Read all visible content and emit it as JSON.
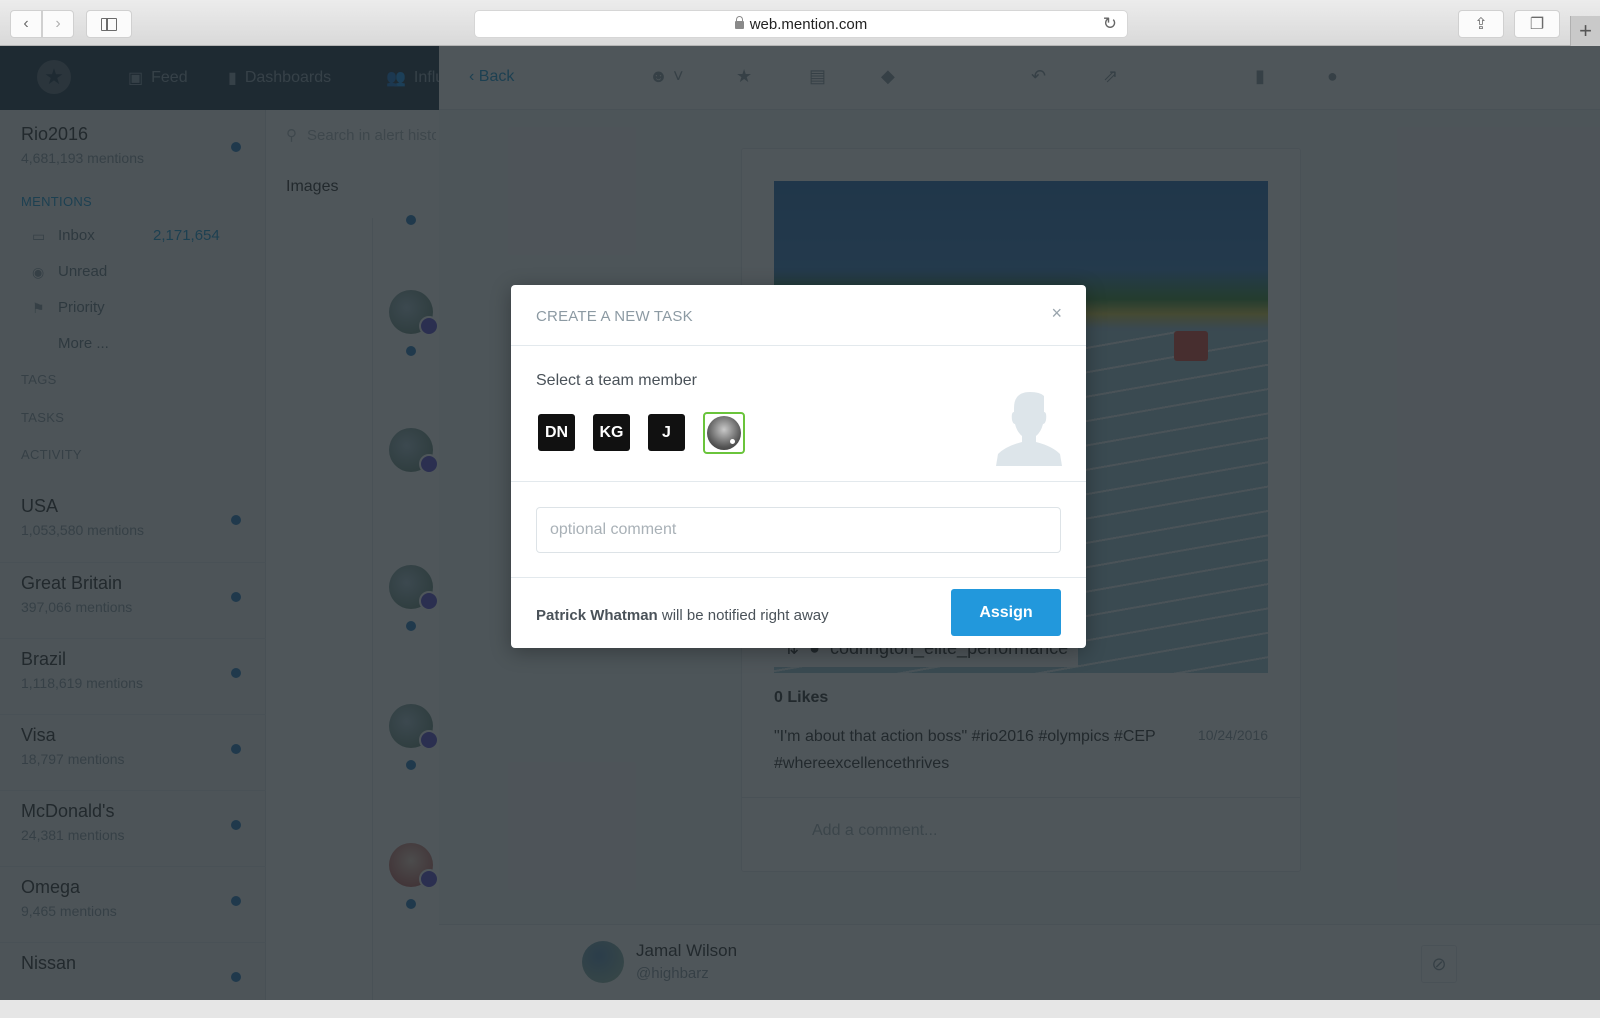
{
  "browser": {
    "url": "web.mention.com",
    "back_icon": "chevron-left-icon",
    "forward_icon": "chevron-right-icon",
    "sidebar_icon": "sidebar-icon",
    "share_icon": "share-icon",
    "tabs_icon": "tabs-icon",
    "new_tab_icon": "plus-icon"
  },
  "topnav": {
    "items": [
      {
        "label": "Feed",
        "icon": "feed-icon"
      },
      {
        "label": "Dashboards",
        "icon": "bar-chart-icon"
      },
      {
        "label": "Influencers",
        "icon": "users-icon"
      }
    ]
  },
  "sidebar": {
    "current_alert": {
      "name": "Rio2016",
      "mentions": "4,681,193 mentions"
    },
    "sections": {
      "mentions": "MENTIONS",
      "tags": "TAGS",
      "tasks": "TASKS",
      "activity": "ACTIVITY"
    },
    "mention_items": [
      {
        "label": "Inbox",
        "count": "2,171,654",
        "icon": "inbox-icon"
      },
      {
        "label": "Unread",
        "count": "",
        "icon": "eye-icon"
      },
      {
        "label": "Priority",
        "count": "",
        "icon": "flag-icon"
      },
      {
        "label": "More ...",
        "count": "",
        "icon": ""
      }
    ],
    "alerts": [
      {
        "name": "USA",
        "mentions": "1,053,580 mentions"
      },
      {
        "name": "Great Britain",
        "mentions": "397,066 mentions"
      },
      {
        "name": "Brazil",
        "mentions": "1,118,619 mentions"
      },
      {
        "name": "Visa",
        "mentions": "18,797 mentions"
      },
      {
        "name": "McDonald's",
        "mentions": "24,381 mentions"
      },
      {
        "name": "Omega",
        "mentions": "9,465 mentions"
      },
      {
        "name": "Nissan",
        "mentions": ""
      }
    ]
  },
  "midcol": {
    "search_placeholder": "Search in alert history",
    "tab": "Images"
  },
  "detail": {
    "back_label": "Back",
    "toolbar_icons": [
      "sentiment-icon",
      "star-icon",
      "archive-icon",
      "tag-icon",
      "reply-all-icon",
      "share-out-icon",
      "trash-icon",
      "alert-icon"
    ],
    "post": {
      "username": "codrington_elite_performance",
      "likes": "0 Likes",
      "caption": "\"I'm about that action boss\" #rio2016 #olympics #CEP #whereexcellencethrives",
      "date": "10/24/2016",
      "comment_placeholder": "Add a comment..."
    },
    "footer": {
      "name": "Jamal Wilson",
      "handle": "@highbarz"
    }
  },
  "modal": {
    "title": "CREATE A NEW TASK",
    "select_label": "Select a team member",
    "members": [
      {
        "initials": "DN",
        "selected": false
      },
      {
        "initials": "KG",
        "selected": false
      },
      {
        "initials": "J",
        "selected": false
      },
      {
        "initials": "",
        "selected": true,
        "type": "photo"
      }
    ],
    "comment_placeholder": "optional comment",
    "comment_value": "",
    "notify_name": "Patrick Whatman",
    "notify_text": " will be notified right away",
    "assign_label": "Assign",
    "accent_color": "#2298dc",
    "selected_border_color": "#6ac43b"
  }
}
